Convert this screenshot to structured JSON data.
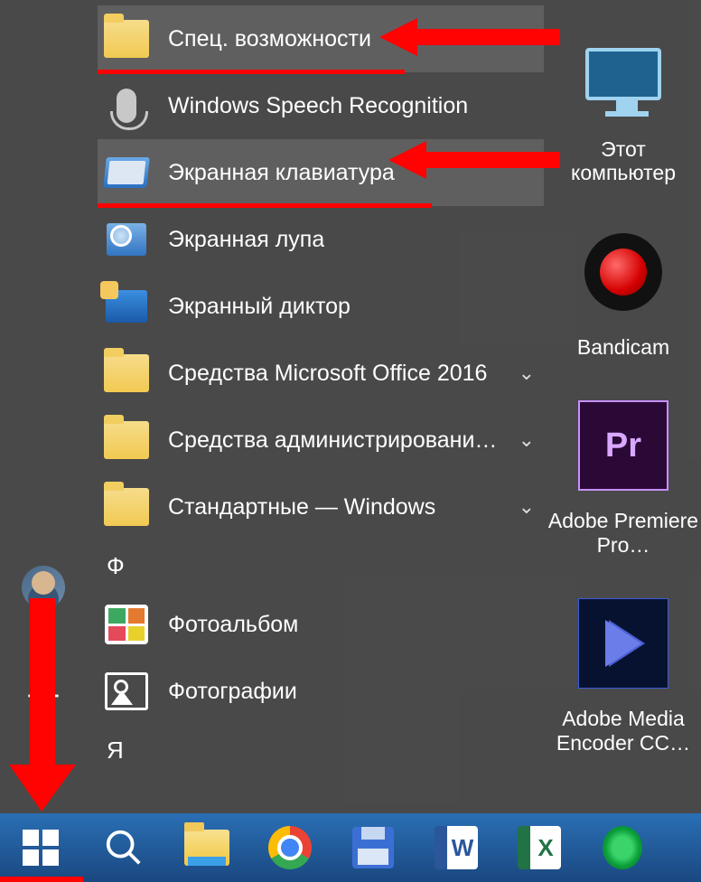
{
  "start_menu": {
    "items": [
      {
        "label": "Спец. возможности",
        "icon": "folder"
      },
      {
        "label": "Windows Speech Recognition",
        "icon": "mic"
      },
      {
        "label": "Экранная клавиатура",
        "icon": "keyboard"
      },
      {
        "label": "Экранная лупа",
        "icon": "magnifier"
      },
      {
        "label": "Экранный диктор",
        "icon": "narrator"
      },
      {
        "label": "Средства Microsoft Office 2016",
        "icon": "folder",
        "expandable": true
      },
      {
        "label": "Средства администрировани…",
        "icon": "folder",
        "expandable": true
      },
      {
        "label": "Стандартные — Windows",
        "icon": "folder",
        "expandable": true
      }
    ],
    "letter_headers": {
      "f": "Ф",
      "ya": "Я"
    },
    "extra_items": [
      {
        "label": "Фотоальбом",
        "icon": "photoalbum"
      },
      {
        "label": "Фотографии",
        "icon": "photos"
      }
    ]
  },
  "tiles": [
    {
      "label": "Этот компьютер",
      "icon": "pc"
    },
    {
      "label": "Bandicam",
      "icon": "bandicam"
    },
    {
      "label": "Adobe Premiere Pro…",
      "icon": "premiere",
      "badge": "Pr"
    },
    {
      "label": "Adobe Media Encoder CC…",
      "icon": "ame"
    }
  ],
  "taskbar": {
    "items": [
      {
        "name": "start",
        "icon": "windows"
      },
      {
        "name": "search",
        "icon": "search"
      },
      {
        "name": "explorer",
        "icon": "explorer"
      },
      {
        "name": "chrome",
        "icon": "chrome"
      },
      {
        "name": "save",
        "icon": "floppy"
      },
      {
        "name": "word",
        "icon": "word",
        "letter": "W"
      },
      {
        "name": "excel",
        "icon": "excel",
        "letter": "X"
      },
      {
        "name": "opera",
        "icon": "opera"
      }
    ]
  },
  "colors": {
    "highlight_red": "#ff0202"
  }
}
